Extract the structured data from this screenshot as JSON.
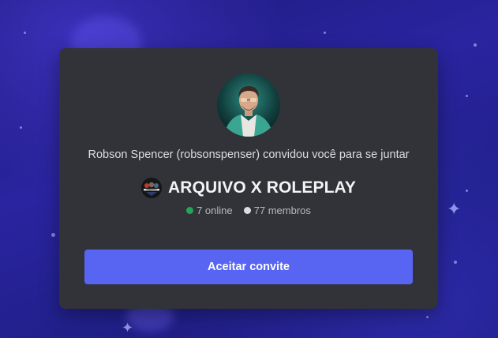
{
  "invite": {
    "inviter_text": "Robson Spencer (robsonspenser) convidou você para se juntar",
    "server_name": "ARQUIVO X ROLEPLAY",
    "online_label": "7 online",
    "members_label": "77 membros",
    "accept_label": "Aceitar convite",
    "server_icon_text": "ARQUIVO X"
  },
  "colors": {
    "accent": "#5865f2",
    "online": "#23a55a",
    "members": "#dbdee1",
    "card": "#313338"
  }
}
